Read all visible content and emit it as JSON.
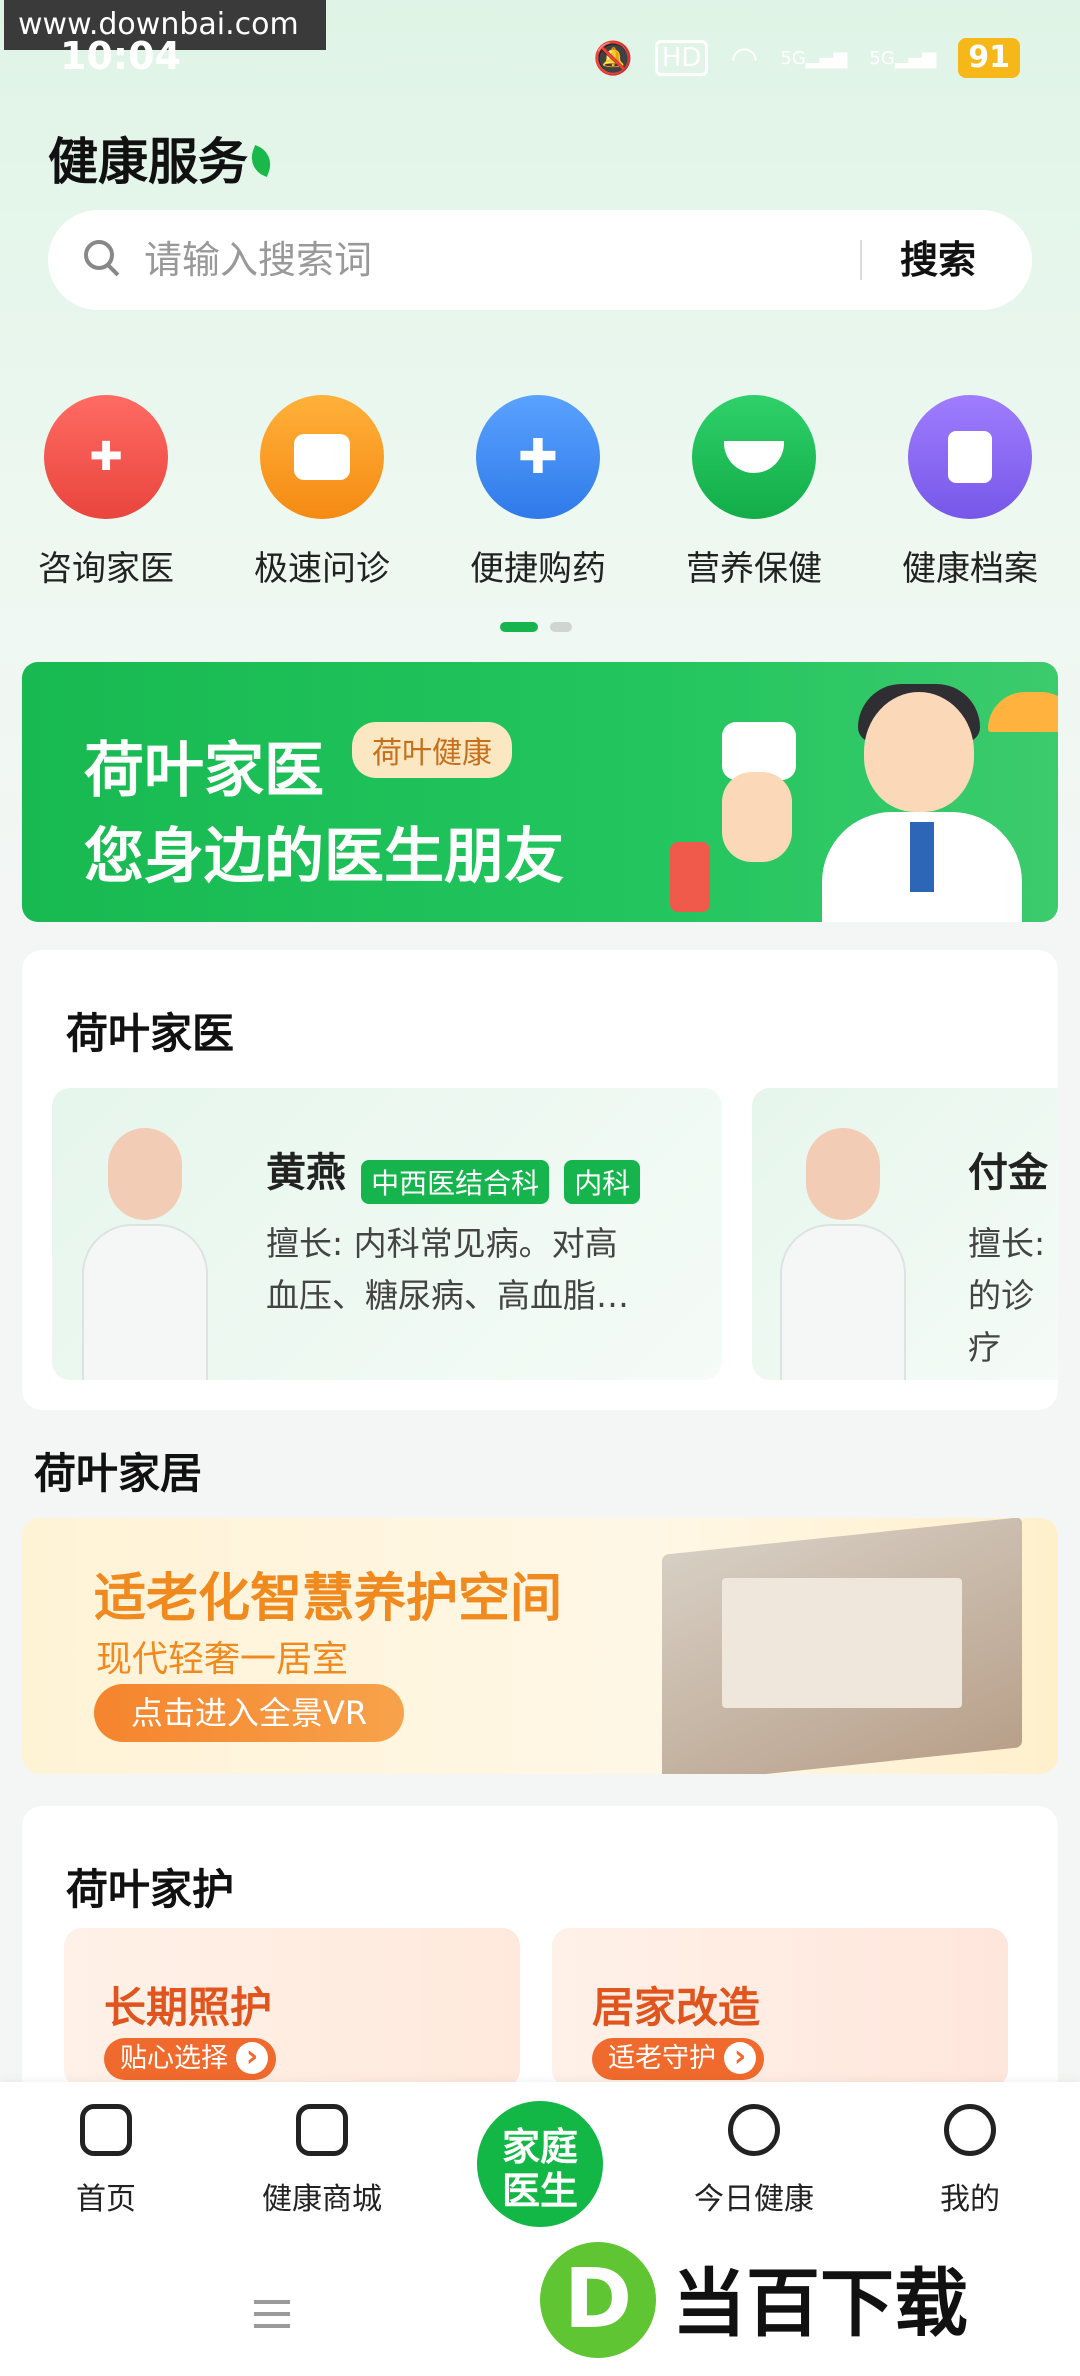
{
  "watermark": "www.downbai.com",
  "status_bar": {
    "time": "10:04",
    "battery": "91",
    "hd": "HD",
    "signal_5g_1": "5G",
    "signal_5g_2": "5G"
  },
  "page_title": "健康服务",
  "search": {
    "placeholder": "请输入搜索词",
    "button": "搜索"
  },
  "services": [
    {
      "label": "咨询家医",
      "icon": "doctor-icon",
      "color": "#f25c54"
    },
    {
      "label": "极速问诊",
      "icon": "chat-icon",
      "color": "#f99b1c"
    },
    {
      "label": "便捷购药",
      "icon": "medicine-bottle-icon",
      "color": "#3d8bf2"
    },
    {
      "label": "营养保健",
      "icon": "mortar-icon",
      "color": "#1fc05a"
    },
    {
      "label": "健康档案",
      "icon": "file-icon",
      "color": "#8b68ee"
    }
  ],
  "banner": {
    "line1": "荷叶家医",
    "badge": "荷叶健康",
    "line2": "您身边的医生朋友"
  },
  "family_doctor": {
    "title": "荷叶家医",
    "doctors": [
      {
        "name": "黄燕",
        "tags": [
          "中西医结合科",
          "内科"
        ],
        "spec_line1": "擅长: 内科常见病。对高",
        "spec_line2": "血压、糖尿病、高血脂…"
      },
      {
        "name": "付金",
        "spec_line1": "擅长:",
        "spec_line2": "的诊疗"
      }
    ]
  },
  "family_home": {
    "title": "荷叶家居",
    "banner_title": "适老化智慧养护空间",
    "banner_sub": "现代轻奢一居室",
    "banner_button": "点击进入全景VR"
  },
  "family_care": {
    "title": "荷叶家护",
    "cards": [
      {
        "title": "长期照护",
        "button": "贴心选择"
      },
      {
        "title": "居家改造",
        "button": "适老守护"
      }
    ]
  },
  "tabs": [
    {
      "label": "首页",
      "icon": "home-icon"
    },
    {
      "label": "健康商城",
      "icon": "shopping-bag-icon"
    },
    {
      "label": "家庭医生",
      "icon": "family-doctor-icon"
    },
    {
      "label": "今日健康",
      "icon": "heart-chat-icon"
    },
    {
      "label": "我的",
      "icon": "profile-icon"
    }
  ],
  "center_tab": {
    "line1": "家庭",
    "line2": "医生"
  },
  "logo_watermark": {
    "d": "D",
    "text": "当百下载"
  }
}
